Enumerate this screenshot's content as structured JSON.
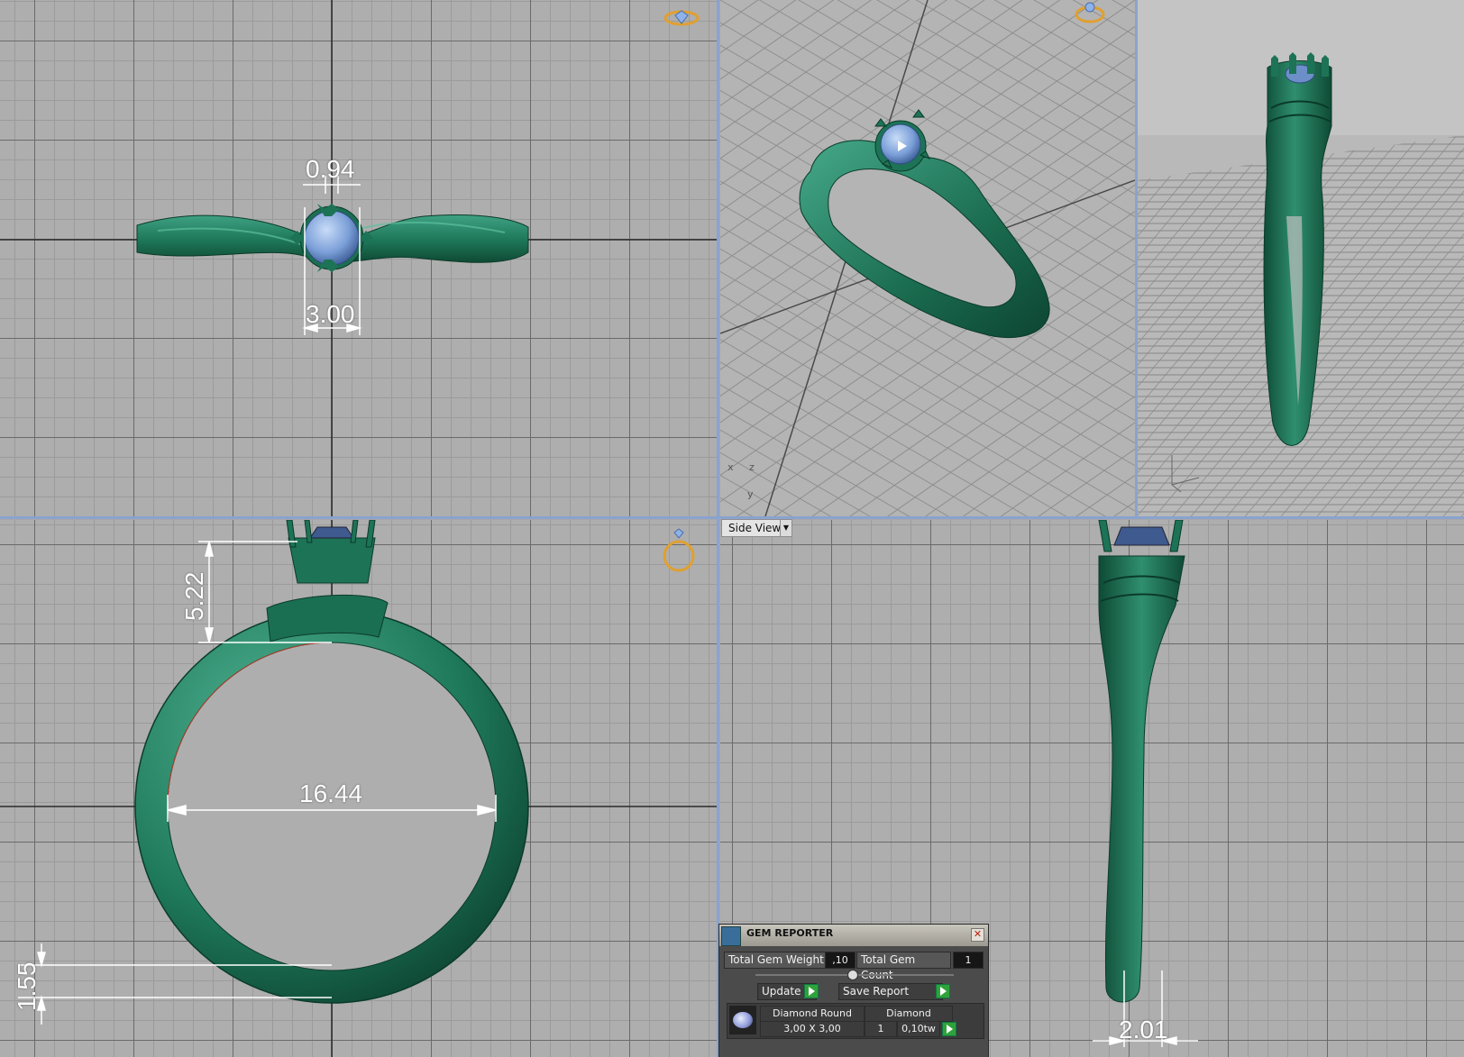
{
  "viewports": {
    "top": {
      "dimensions": {
        "prong_gap": "0.94",
        "stone_width": "3.00"
      }
    },
    "front": {
      "dimensions": {
        "head_height": "5.22",
        "inner_diameter": "16.44",
        "shank_thickness": "1.55"
      }
    },
    "side": {
      "view_label": "Side View",
      "dimensions": {
        "shank_width": "2.01"
      }
    },
    "perspective": {
      "axis_labels": [
        "x",
        "z",
        "y"
      ]
    }
  },
  "gem_reporter": {
    "title": "GEM REPORTER",
    "total_weight_label": "Total Gem Weight",
    "total_weight_value": ",10",
    "total_count_label": "Total Gem Count",
    "total_count_value": "1",
    "update_label": "Update",
    "save_report_label": "Save Report",
    "gem_row": {
      "name": "Diamond Round",
      "size": "3,00 X 3,00",
      "material": "Diamond",
      "count": "1",
      "weight": "0,10tw"
    }
  },
  "colors": {
    "metal": "#1e7a5a",
    "stone": "#7b9fd8",
    "separator": "#8aa3cf",
    "navicube": "#e0a030"
  }
}
